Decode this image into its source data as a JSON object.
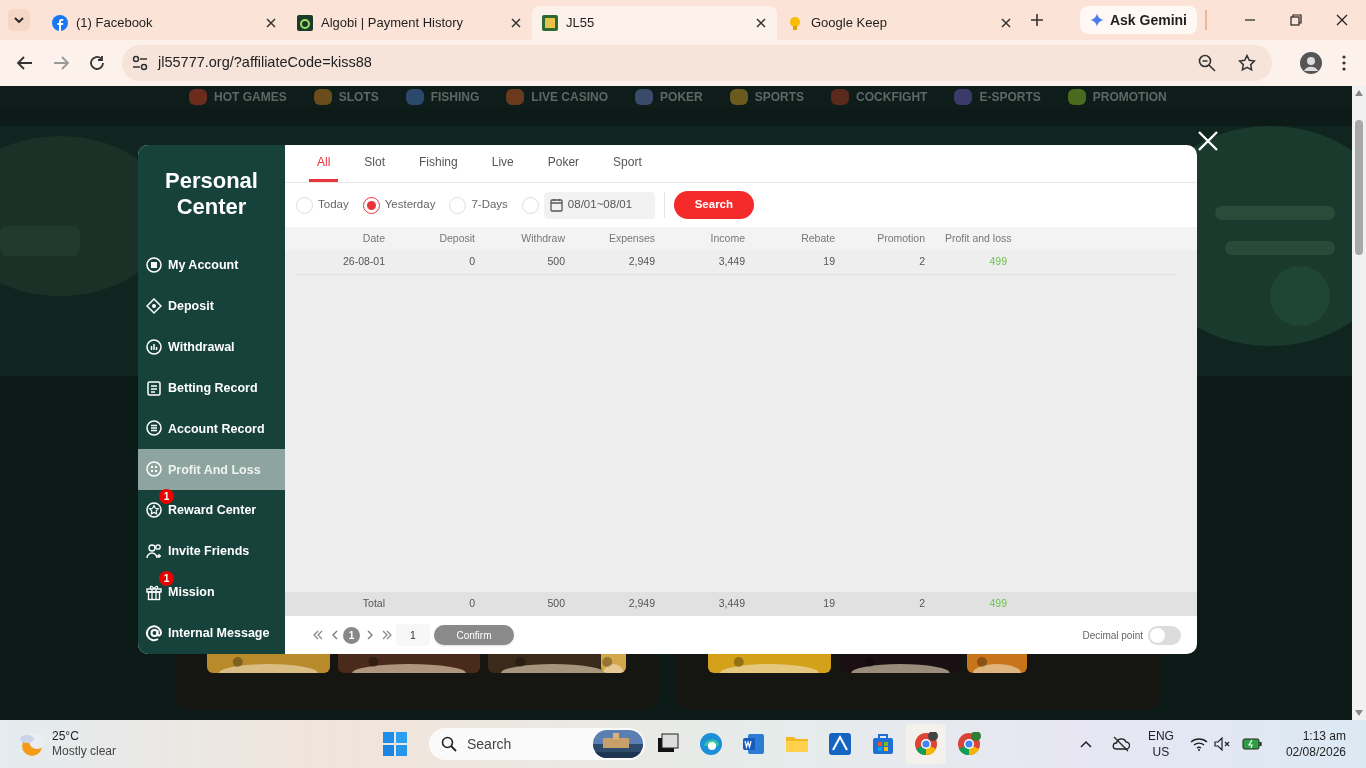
{
  "browser": {
    "tabs": [
      {
        "title": "(1) Facebook",
        "selected": false
      },
      {
        "title": "Algobi | Payment History",
        "selected": false
      },
      {
        "title": "JL55",
        "selected": true
      },
      {
        "title": "Google Keep",
        "selected": false
      }
    ],
    "ask_gemini": "Ask Gemini",
    "url": "jl55777.org/?affiliateCode=kiss88"
  },
  "site_nav": [
    "HOT GAMES",
    "SLOTS",
    "FISHING",
    "LIVE CASINO",
    "POKER",
    "SPORTS",
    "COCKFIGHT",
    "E-SPORTS",
    "PROMOTION"
  ],
  "modal": {
    "title": "Personal Center",
    "menu": [
      {
        "label": "My Account",
        "selected": false
      },
      {
        "label": "Deposit",
        "selected": false
      },
      {
        "label": "Withdrawal",
        "selected": false
      },
      {
        "label": "Betting Record",
        "selected": false
      },
      {
        "label": "Account Record",
        "selected": false
      },
      {
        "label": "Profit And Loss",
        "selected": true
      },
      {
        "label": "Reward Center",
        "selected": false,
        "badge": "1"
      },
      {
        "label": "Invite Friends",
        "selected": false
      },
      {
        "label": "Mission",
        "selected": false,
        "badge": "1"
      },
      {
        "label": "Internal Message",
        "selected": false
      }
    ],
    "game_tabs": [
      {
        "label": "All",
        "selected": true
      },
      {
        "label": "Slot",
        "selected": false
      },
      {
        "label": "Fishing",
        "selected": false
      },
      {
        "label": "Live",
        "selected": false
      },
      {
        "label": "Poker",
        "selected": false
      },
      {
        "label": "Sport",
        "selected": false
      }
    ],
    "date_filters": [
      {
        "label": "Today",
        "selected": false
      },
      {
        "label": "Yesterday",
        "selected": true
      },
      {
        "label": "7-Days",
        "selected": false
      }
    ],
    "custom_range": {
      "selected": false,
      "value": "08/01~08/01"
    },
    "search_button": "Search",
    "table": {
      "columns": [
        "Date",
        "Deposit",
        "Withdraw",
        "Expenses",
        "Income",
        "Rebate",
        "Promotion",
        "Profit and loss"
      ],
      "rows": [
        [
          "26-08-01",
          "0",
          "500",
          "2,949",
          "3,449",
          "19",
          "2",
          "499"
        ]
      ],
      "total": [
        "Total",
        "0",
        "500",
        "2,949",
        "3,449",
        "19",
        "2",
        "499"
      ]
    },
    "pagination": {
      "current_page": "1",
      "page_input": "1",
      "confirm": "Confirm"
    },
    "decimal_point": {
      "label": "Decimal point",
      "on": false
    }
  },
  "taskbar": {
    "temperature": "25°C",
    "weather": "Mostly clear",
    "search": "Search",
    "language": "ENG",
    "region": "US",
    "time": "1:13 am",
    "date": "02/08/2026"
  }
}
